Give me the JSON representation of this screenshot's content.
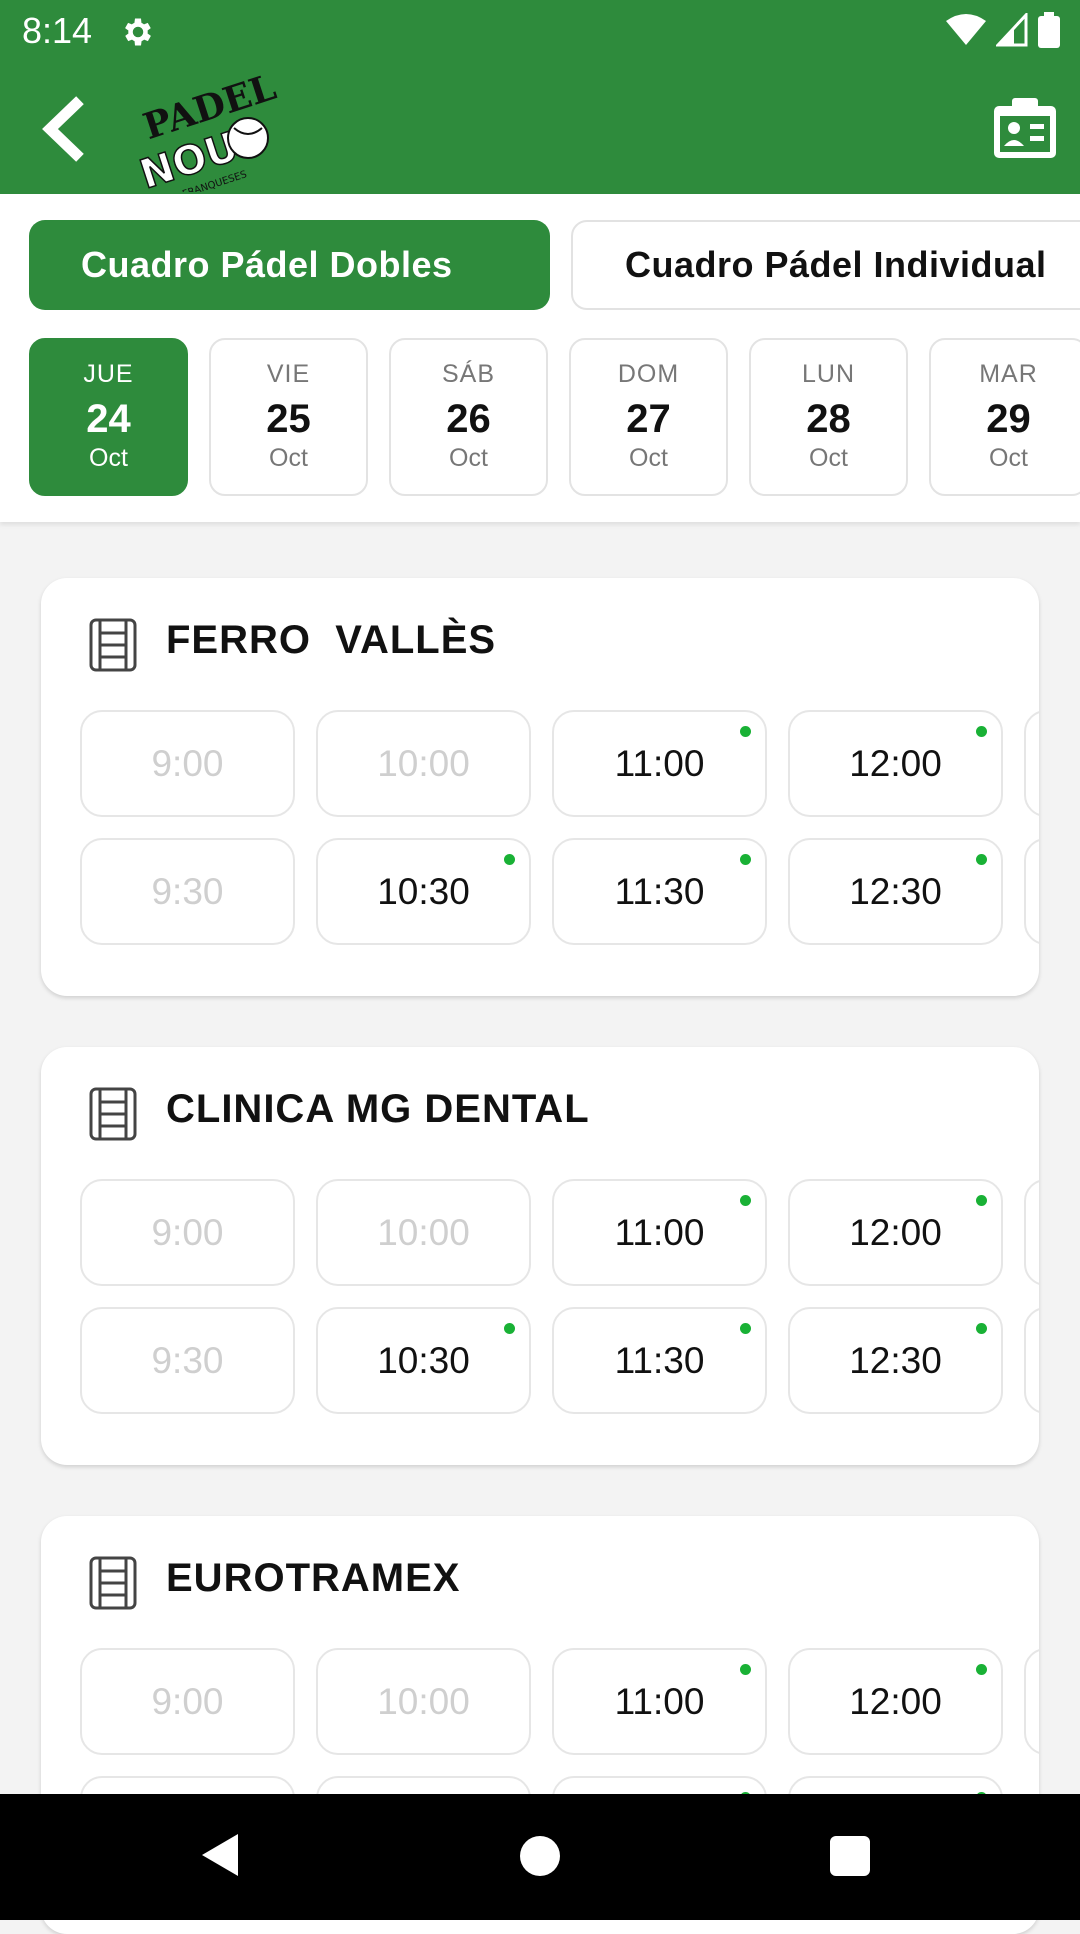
{
  "status_bar": {
    "time": "8:14"
  },
  "app_bar": {
    "logo_text_top": "PADEL",
    "logo_text_main": "NOU",
    "logo_text_sub": "LES FRANQUESES"
  },
  "categories": [
    {
      "label": "Cuadro Pádel Dobles",
      "active": true
    },
    {
      "label": "Cuadro Pádel Individual",
      "active": false
    }
  ],
  "days": [
    {
      "weekday": "JUE",
      "day": "24",
      "month": "Oct",
      "active": true
    },
    {
      "weekday": "VIE",
      "day": "25",
      "month": "Oct",
      "active": false
    },
    {
      "weekday": "SÁB",
      "day": "26",
      "month": "Oct",
      "active": false
    },
    {
      "weekday": "DOM",
      "day": "27",
      "month": "Oct",
      "active": false
    },
    {
      "weekday": "LUN",
      "day": "28",
      "month": "Oct",
      "active": false
    },
    {
      "weekday": "MAR",
      "day": "29",
      "month": "Oct",
      "active": false
    }
  ],
  "courts": [
    {
      "name": "FERRO  VALLÈS",
      "slots_row1": [
        {
          "time": "9:00",
          "available": false
        },
        {
          "time": "10:00",
          "available": false
        },
        {
          "time": "11:00",
          "available": true
        },
        {
          "time": "12:00",
          "available": true
        }
      ],
      "slots_row2": [
        {
          "time": "9:30",
          "available": false
        },
        {
          "time": "10:30",
          "available": true
        },
        {
          "time": "11:30",
          "available": true
        },
        {
          "time": "12:30",
          "available": true
        }
      ]
    },
    {
      "name": "CLINICA MG DENTAL",
      "slots_row1": [
        {
          "time": "9:00",
          "available": false
        },
        {
          "time": "10:00",
          "available": false
        },
        {
          "time": "11:00",
          "available": true
        },
        {
          "time": "12:00",
          "available": true
        }
      ],
      "slots_row2": [
        {
          "time": "9:30",
          "available": false
        },
        {
          "time": "10:30",
          "available": true
        },
        {
          "time": "11:30",
          "available": true
        },
        {
          "time": "12:30",
          "available": true
        }
      ]
    },
    {
      "name": "EUROTRAMEX",
      "slots_row1": [
        {
          "time": "9:00",
          "available": false
        },
        {
          "time": "10:00",
          "available": false
        },
        {
          "time": "11:00",
          "available": true
        },
        {
          "time": "12:00",
          "available": true
        }
      ],
      "slots_row2": [
        {
          "time": "",
          "available": false
        },
        {
          "time": "",
          "available": false
        },
        {
          "time": "",
          "available": true
        },
        {
          "time": "",
          "available": true
        }
      ]
    }
  ],
  "colors": {
    "brand_green": "#2e8b3c",
    "available_dot": "#19b135",
    "disabled_text": "#cfcfcf"
  }
}
